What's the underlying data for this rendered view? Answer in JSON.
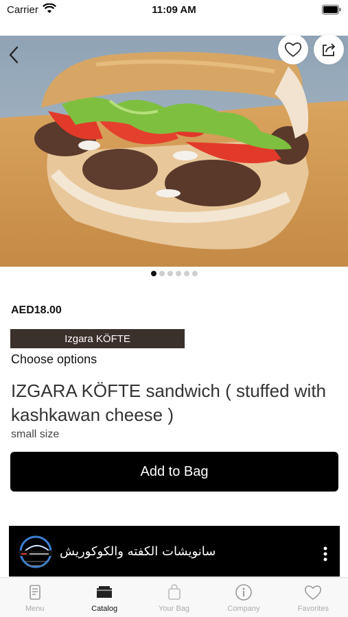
{
  "status_bar": {
    "carrier": "Carrier",
    "time": "11:09 AM"
  },
  "product": {
    "price": "AED18.00",
    "variant": "Izgara KÖFTE",
    "choose_options": "Choose options",
    "title": "IZGARA KÖFTE  sandwich ( stuffed with kashkawan cheese )",
    "size": "small size",
    "add_to_bag": "Add to Bag",
    "gallery": {
      "pages": 6,
      "current": 1
    }
  },
  "store": {
    "name": "سانويشات الكفته والكوكوريش"
  },
  "tabs": [
    {
      "label": "Menu",
      "icon": "menu-book-icon"
    },
    {
      "label": "Catalog",
      "icon": "catalog-icon",
      "active": true
    },
    {
      "label": "Your Bag",
      "icon": "bag-icon"
    },
    {
      "label": "Company",
      "icon": "info-icon"
    },
    {
      "label": "Favorites",
      "icon": "heart-icon"
    }
  ],
  "colors": {
    "variant_chip_bg": "#3a302c",
    "primary_button": "#000000"
  }
}
